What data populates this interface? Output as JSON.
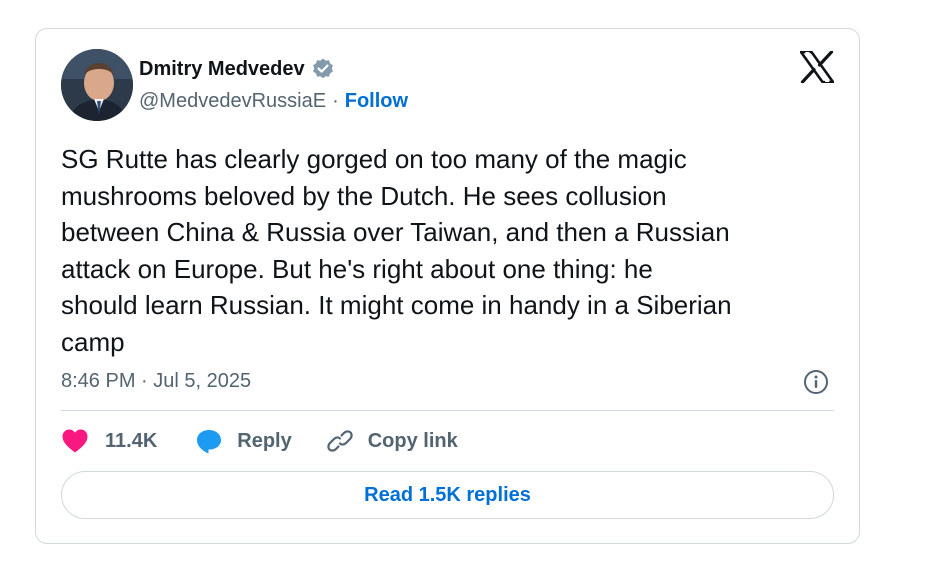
{
  "author": {
    "display_name": "Dmitry Medvedev",
    "handle": "@MedvedevRussiaE",
    "separator": "·",
    "follow_label": "Follow",
    "verified": true
  },
  "brand": {
    "icon": "x-logo-icon"
  },
  "tweet": {
    "text": "SG Rutte has clearly gorged on too many of the magic\nmushrooms beloved by the Dutch. He sees collusion\nbetween China & Russia over Taiwan, and then a Russian\nattack on Europe. But he's right about one thing: he\nshould learn Russian. It might come in handy in a Siberian\ncamp",
    "timestamp": "8:46 PM · Jul 5, 2025"
  },
  "actions": {
    "like_count": "11.4K",
    "reply_label": "Reply",
    "copy_link_label": "Copy link"
  },
  "replies_button": "Read 1.5K replies",
  "colors": {
    "accent": "#006fd6",
    "like": "#f91880",
    "reply_icon": "#1d9bf0",
    "muted": "#536471",
    "border": "#cfd9de",
    "verified": "#829aab"
  }
}
